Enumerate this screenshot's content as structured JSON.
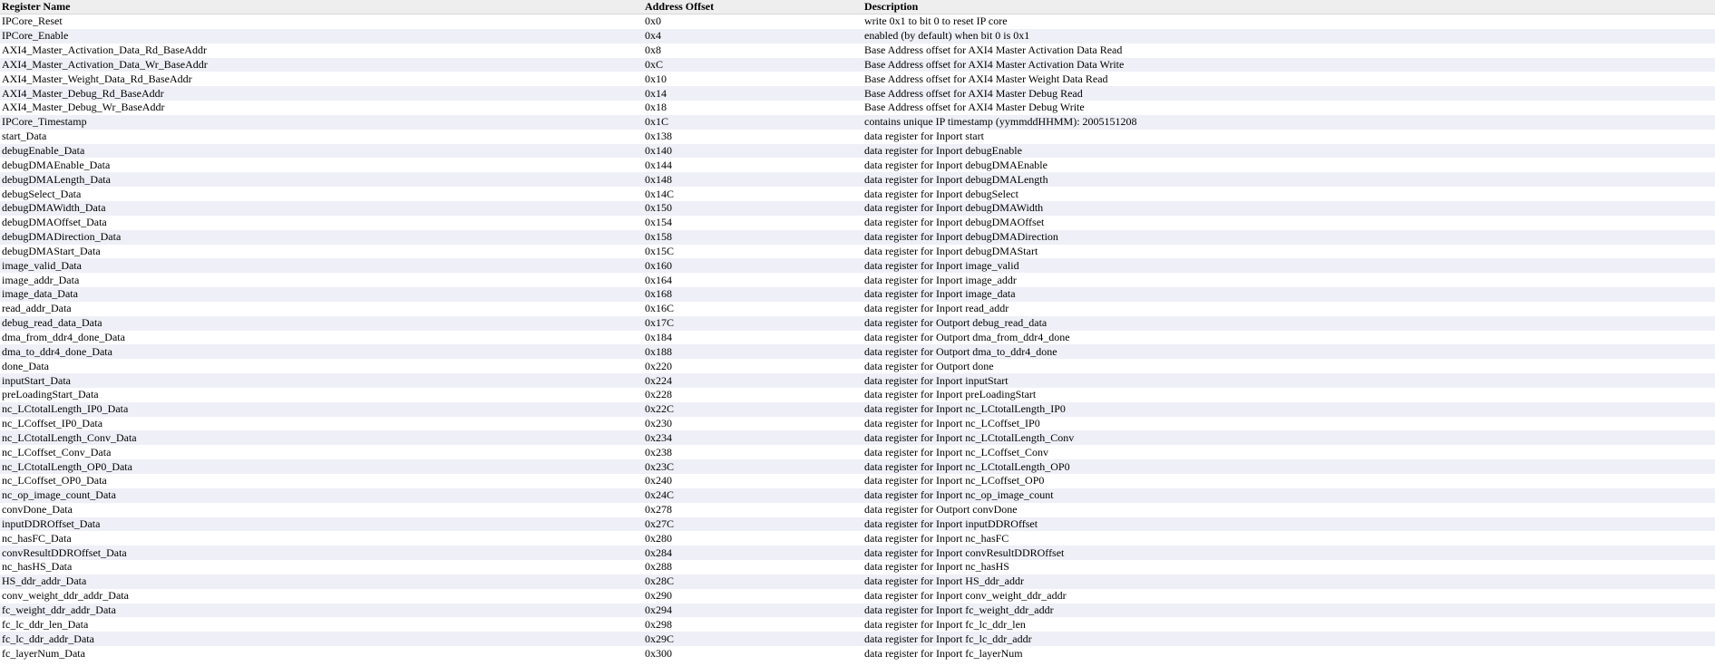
{
  "table": {
    "headers": {
      "name": "Register Name",
      "offset": "Address Offset",
      "description": "Description"
    },
    "rows": [
      {
        "name": "IPCore_Reset",
        "offset": "0x0",
        "description": "write 0x1 to bit 0 to reset IP core"
      },
      {
        "name": "IPCore_Enable",
        "offset": "0x4",
        "description": "enabled (by default) when bit 0 is 0x1"
      },
      {
        "name": "AXI4_Master_Activation_Data_Rd_BaseAddr",
        "offset": "0x8",
        "description": "Base Address offset for AXI4 Master Activation Data Read"
      },
      {
        "name": "AXI4_Master_Activation_Data_Wr_BaseAddr",
        "offset": "0xC",
        "description": "Base Address offset for AXI4 Master Activation Data Write"
      },
      {
        "name": "AXI4_Master_Weight_Data_Rd_BaseAddr",
        "offset": "0x10",
        "description": "Base Address offset for AXI4 Master Weight Data Read"
      },
      {
        "name": "AXI4_Master_Debug_Rd_BaseAddr",
        "offset": "0x14",
        "description": "Base Address offset for AXI4 Master Debug Read"
      },
      {
        "name": "AXI4_Master_Debug_Wr_BaseAddr",
        "offset": "0x18",
        "description": "Base Address offset for AXI4 Master Debug Write"
      },
      {
        "name": "IPCore_Timestamp",
        "offset": "0x1C",
        "description": "contains unique IP timestamp (yymmddHHMM): 2005151208"
      },
      {
        "name": "start_Data",
        "offset": "0x138",
        "description": "data register for Inport start"
      },
      {
        "name": "debugEnable_Data",
        "offset": "0x140",
        "description": "data register for Inport debugEnable"
      },
      {
        "name": "debugDMAEnable_Data",
        "offset": "0x144",
        "description": "data register for Inport debugDMAEnable"
      },
      {
        "name": "debugDMALength_Data",
        "offset": "0x148",
        "description": "data register for Inport debugDMALength"
      },
      {
        "name": "debugSelect_Data",
        "offset": "0x14C",
        "description": "data register for Inport debugSelect"
      },
      {
        "name": "debugDMAWidth_Data",
        "offset": "0x150",
        "description": "data register for Inport debugDMAWidth"
      },
      {
        "name": "debugDMAOffset_Data",
        "offset": "0x154",
        "description": "data register for Inport debugDMAOffset"
      },
      {
        "name": "debugDMADirection_Data",
        "offset": "0x158",
        "description": "data register for Inport debugDMADirection"
      },
      {
        "name": "debugDMAStart_Data",
        "offset": "0x15C",
        "description": "data register for Inport debugDMAStart"
      },
      {
        "name": "image_valid_Data",
        "offset": "0x160",
        "description": "data register for Inport image_valid"
      },
      {
        "name": "image_addr_Data",
        "offset": "0x164",
        "description": "data register for Inport image_addr"
      },
      {
        "name": "image_data_Data",
        "offset": "0x168",
        "description": "data register for Inport image_data"
      },
      {
        "name": "read_addr_Data",
        "offset": "0x16C",
        "description": "data register for Inport read_addr"
      },
      {
        "name": "debug_read_data_Data",
        "offset": "0x17C",
        "description": "data register for Outport debug_read_data"
      },
      {
        "name": "dma_from_ddr4_done_Data",
        "offset": "0x184",
        "description": "data register for Outport dma_from_ddr4_done"
      },
      {
        "name": "dma_to_ddr4_done_Data",
        "offset": "0x188",
        "description": "data register for Outport dma_to_ddr4_done"
      },
      {
        "name": "done_Data",
        "offset": "0x220",
        "description": "data register for Outport done"
      },
      {
        "name": "inputStart_Data",
        "offset": "0x224",
        "description": "data register for Inport inputStart"
      },
      {
        "name": "preLoadingStart_Data",
        "offset": "0x228",
        "description": "data register for Inport preLoadingStart"
      },
      {
        "name": "nc_LCtotalLength_IP0_Data",
        "offset": "0x22C",
        "description": "data register for Inport nc_LCtotalLength_IP0"
      },
      {
        "name": "nc_LCoffset_IP0_Data",
        "offset": "0x230",
        "description": "data register for Inport nc_LCoffset_IP0"
      },
      {
        "name": "nc_LCtotalLength_Conv_Data",
        "offset": "0x234",
        "description": "data register for Inport nc_LCtotalLength_Conv"
      },
      {
        "name": "nc_LCoffset_Conv_Data",
        "offset": "0x238",
        "description": "data register for Inport nc_LCoffset_Conv"
      },
      {
        "name": "nc_LCtotalLength_OP0_Data",
        "offset": "0x23C",
        "description": "data register for Inport nc_LCtotalLength_OP0"
      },
      {
        "name": "nc_LCoffset_OP0_Data",
        "offset": "0x240",
        "description": "data register for Inport nc_LCoffset_OP0"
      },
      {
        "name": "nc_op_image_count_Data",
        "offset": "0x24C",
        "description": "data register for Inport nc_op_image_count"
      },
      {
        "name": "convDone_Data",
        "offset": "0x278",
        "description": "data register for Outport convDone"
      },
      {
        "name": "inputDDROffset_Data",
        "offset": "0x27C",
        "description": "data register for Inport inputDDROffset"
      },
      {
        "name": "nc_hasFC_Data",
        "offset": "0x280",
        "description": "data register for Inport nc_hasFC"
      },
      {
        "name": "convResultDDROffset_Data",
        "offset": "0x284",
        "description": "data register for Inport convResultDDROffset"
      },
      {
        "name": "nc_hasHS_Data",
        "offset": "0x288",
        "description": "data register for Inport nc_hasHS"
      },
      {
        "name": "HS_ddr_addr_Data",
        "offset": "0x28C",
        "description": "data register for Inport HS_ddr_addr"
      },
      {
        "name": "conv_weight_ddr_addr_Data",
        "offset": "0x290",
        "description": "data register for Inport conv_weight_ddr_addr"
      },
      {
        "name": "fc_weight_ddr_addr_Data",
        "offset": "0x294",
        "description": "data register for Inport fc_weight_ddr_addr"
      },
      {
        "name": "fc_lc_ddr_len_Data",
        "offset": "0x298",
        "description": "data register for Inport fc_lc_ddr_len"
      },
      {
        "name": "fc_lc_ddr_addr_Data",
        "offset": "0x29C",
        "description": "data register for Inport fc_lc_ddr_addr"
      },
      {
        "name": "fc_layerNum_Data",
        "offset": "0x300",
        "description": "data register for Inport fc_layerNum"
      }
    ]
  }
}
